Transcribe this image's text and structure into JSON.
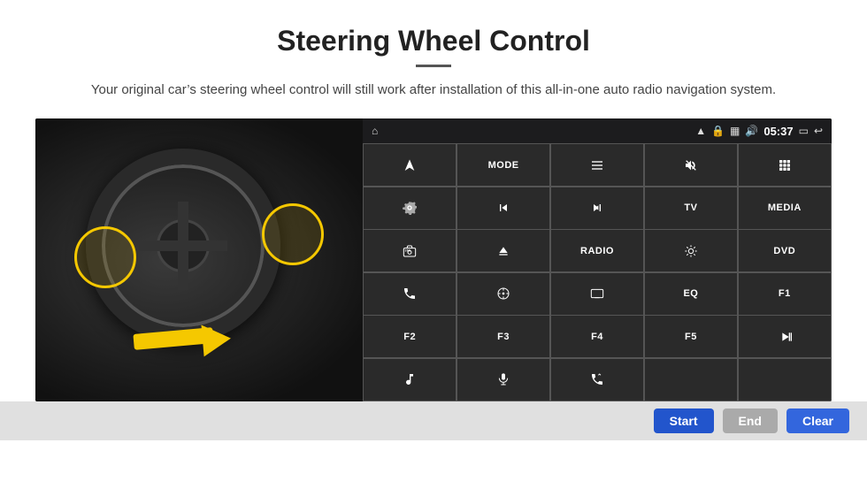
{
  "page": {
    "title": "Steering Wheel Control",
    "subtitle": "Your original car’s steering wheel control will still work after installation of this all-in-one auto radio navigation system."
  },
  "status_bar": {
    "time": "05:37",
    "icons": [
      "wifi",
      "lock",
      "sim",
      "bluetooth",
      "rect",
      "back"
    ]
  },
  "grid_buttons": [
    {
      "id": "nav-icon",
      "type": "icon",
      "icon": "nav",
      "text": ""
    },
    {
      "id": "mode-btn",
      "type": "text",
      "text": "MODE"
    },
    {
      "id": "list-btn",
      "type": "icon",
      "icon": "list",
      "text": ""
    },
    {
      "id": "mute-btn",
      "type": "icon",
      "icon": "mute",
      "text": ""
    },
    {
      "id": "apps-btn",
      "type": "icon",
      "icon": "apps",
      "text": ""
    },
    {
      "id": "settings-btn",
      "type": "icon",
      "icon": "settings",
      "text": ""
    },
    {
      "id": "prev-btn",
      "type": "icon",
      "icon": "prev",
      "text": ""
    },
    {
      "id": "next-btn",
      "type": "icon",
      "icon": "next",
      "text": ""
    },
    {
      "id": "tv-btn",
      "type": "text",
      "text": "TV"
    },
    {
      "id": "media-btn",
      "type": "text",
      "text": "MEDIA"
    },
    {
      "id": "cam360-btn",
      "type": "icon",
      "icon": "cam360",
      "text": ""
    },
    {
      "id": "eject-btn",
      "type": "icon",
      "icon": "eject",
      "text": ""
    },
    {
      "id": "radio-btn",
      "type": "text",
      "text": "RADIO"
    },
    {
      "id": "brightness-btn",
      "type": "icon",
      "icon": "sun",
      "text": ""
    },
    {
      "id": "dvd-btn",
      "type": "text",
      "text": "DVD"
    },
    {
      "id": "phone-btn",
      "type": "icon",
      "icon": "phone",
      "text": ""
    },
    {
      "id": "navi-btn",
      "type": "icon",
      "icon": "navi",
      "text": ""
    },
    {
      "id": "screen-btn",
      "type": "icon",
      "icon": "screen",
      "text": ""
    },
    {
      "id": "eq-btn",
      "type": "text",
      "text": "EQ"
    },
    {
      "id": "f1-btn",
      "type": "text",
      "text": "F1"
    },
    {
      "id": "f2-btn",
      "type": "text",
      "text": "F2"
    },
    {
      "id": "f3-btn",
      "type": "text",
      "text": "F3"
    },
    {
      "id": "f4-btn",
      "type": "text",
      "text": "F4"
    },
    {
      "id": "f5-btn",
      "type": "text",
      "text": "F5"
    },
    {
      "id": "playpause-btn",
      "type": "icon",
      "icon": "playpause",
      "text": ""
    },
    {
      "id": "music-btn",
      "type": "icon",
      "icon": "music",
      "text": ""
    },
    {
      "id": "mic-btn",
      "type": "icon",
      "icon": "mic",
      "text": ""
    },
    {
      "id": "call-btn",
      "type": "icon",
      "icon": "call",
      "text": ""
    },
    {
      "id": "empty1",
      "type": "empty",
      "text": ""
    },
    {
      "id": "empty2",
      "type": "empty",
      "text": ""
    }
  ],
  "bottom_bar": {
    "start_label": "Start",
    "end_label": "End",
    "clear_label": "Clear"
  }
}
